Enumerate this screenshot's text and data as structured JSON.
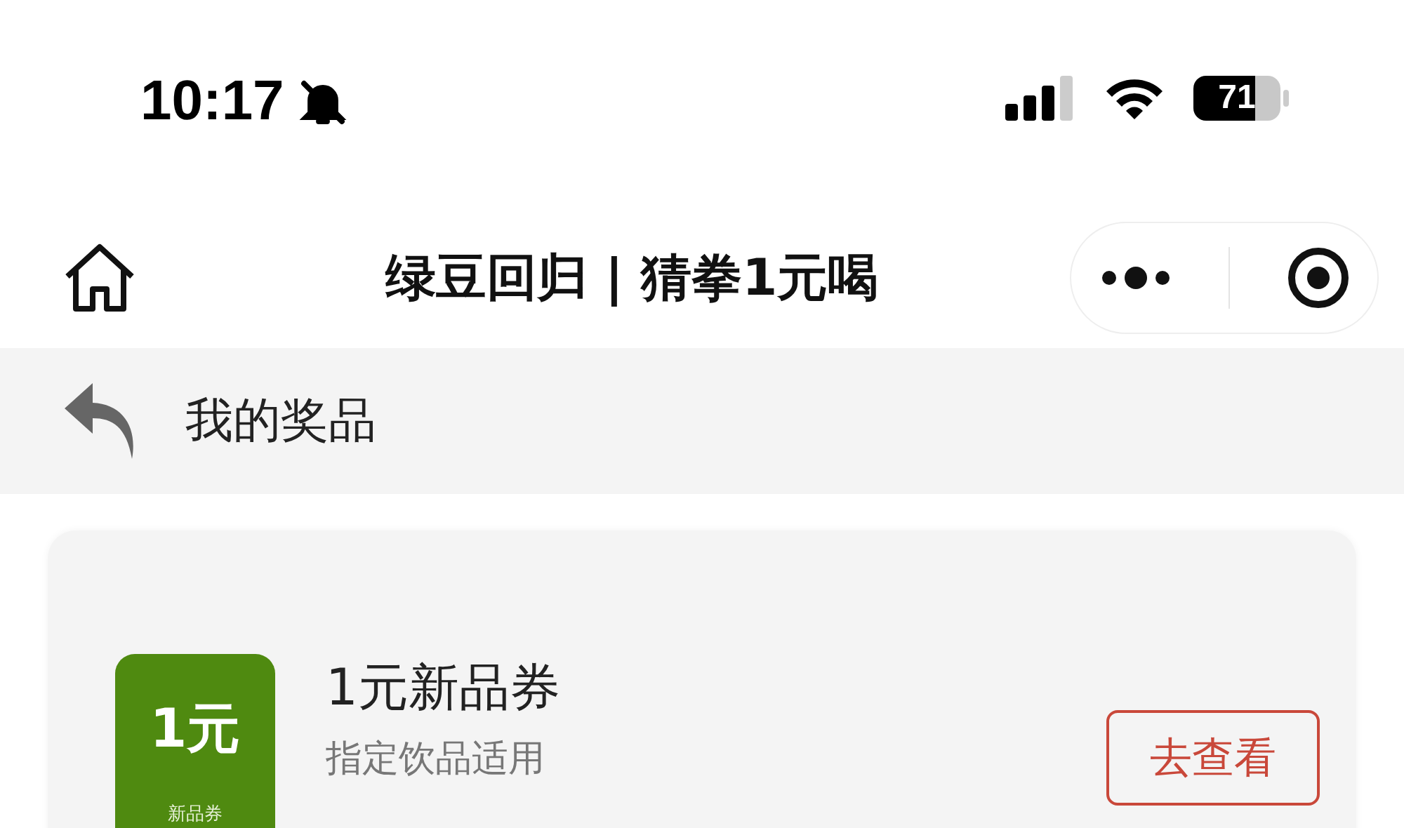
{
  "status_bar": {
    "time": "10:17",
    "muted": true,
    "battery": "71"
  },
  "nav": {
    "title": "绿豆回归 | 猜拳1元喝"
  },
  "header": {
    "title": "我的奖品"
  },
  "prizes": [
    {
      "badge_amount": "1元",
      "badge_label": "新品券",
      "title": "1元新品券",
      "subtitle": "指定饮品适用",
      "action": "去查看"
    }
  ]
}
